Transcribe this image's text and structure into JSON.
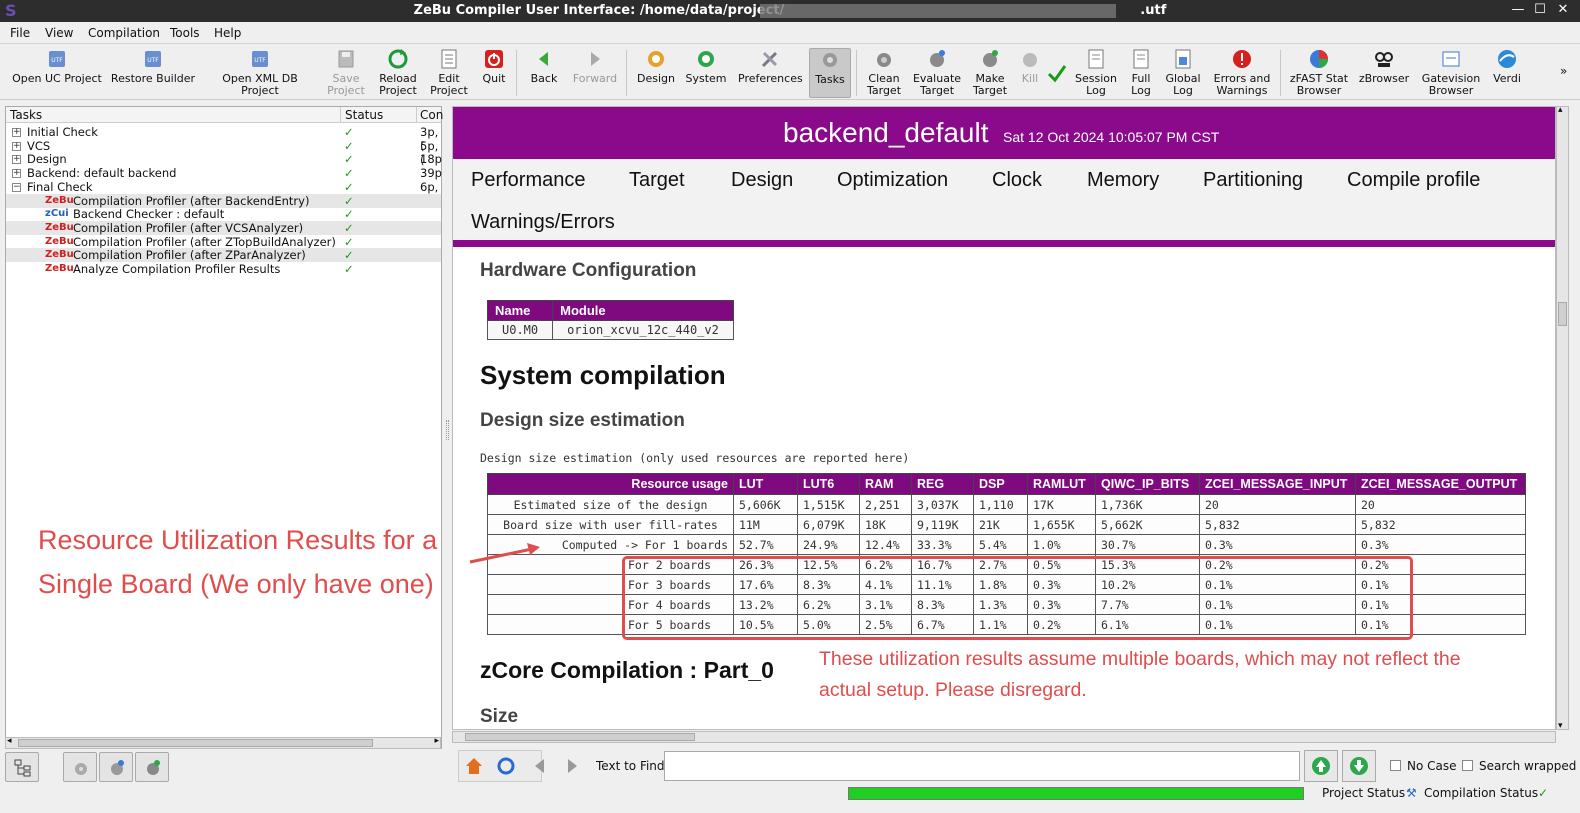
{
  "window": {
    "title": "ZeBu Compiler User Interface: /home/data/project/",
    "title_suffix": ".utf",
    "controls": [
      "—",
      "☐",
      "✕"
    ]
  },
  "menu": [
    "File",
    "View",
    "Compilation",
    "Tools",
    "Help"
  ],
  "toolbar": [
    {
      "line1": "Open UC Project",
      "line2": "",
      "icon": "utf-file-icon"
    },
    {
      "line1": "Restore Builder",
      "line2": "",
      "icon": "utf-file-icon"
    },
    {
      "line1": "Open XML DB Project",
      "line2": "",
      "icon": "utf-file-icon"
    },
    {
      "line1": "Save",
      "line2": "Project",
      "icon": "save-icon",
      "disabled": true
    },
    {
      "line1": "Reload",
      "line2": "Project",
      "icon": "reload-icon"
    },
    {
      "line1": "Edit",
      "line2": "Project",
      "icon": "edit-icon"
    },
    {
      "line1": "Quit",
      "line2": "",
      "icon": "quit-icon"
    },
    {
      "line1": "Back",
      "line2": "",
      "icon": "back-arrow-icon"
    },
    {
      "line1": "Forward",
      "line2": "",
      "icon": "forward-arrow-icon",
      "disabled": true
    },
    {
      "line1": "Design",
      "line2": "",
      "icon": "design-icon"
    },
    {
      "line1": "System",
      "line2": "",
      "icon": "system-icon"
    },
    {
      "line1": "Preferences",
      "line2": "",
      "icon": "preferences-icon"
    },
    {
      "line1": "Tasks",
      "line2": "",
      "icon": "tasks-icon",
      "active": true
    },
    {
      "line1": "Clean",
      "line2": "Target",
      "icon": "clean-target-icon"
    },
    {
      "line1": "Evaluate",
      "line2": "Target",
      "icon": "evaluate-target-icon"
    },
    {
      "line1": "Make",
      "line2": "Target",
      "icon": "make-target-icon"
    },
    {
      "line1": "Kill",
      "line2": "",
      "icon": "kill-icon",
      "disabled": true
    },
    {
      "line1": "Session",
      "line2": "Log",
      "icon": "session-log-icon"
    },
    {
      "line1": "Full",
      "line2": "Log",
      "icon": "full-log-icon"
    },
    {
      "line1": "Global",
      "line2": "Log",
      "icon": "global-log-icon"
    },
    {
      "line1": "Errors and",
      "line2": "Warnings",
      "icon": "errors-icon"
    },
    {
      "line1": "zFAST Stat",
      "line2": "Browser",
      "icon": "zfast-icon"
    },
    {
      "line1": "zBrowser",
      "line2": "",
      "icon": "zbrowser-icon"
    },
    {
      "line1": "Gatevision",
      "line2": "Browser",
      "icon": "gatevision-icon"
    },
    {
      "line1": "Verdi",
      "line2": "",
      "icon": "verdi-icon"
    }
  ],
  "tasks": {
    "headers": [
      "Tasks",
      "Status",
      "Con"
    ],
    "rows": [
      {
        "label": "Initial Check",
        "con": "3p,(",
        "kind": "group",
        "exp": "+"
      },
      {
        "label": "VCS",
        "con": "5p,(",
        "kind": "group",
        "exp": "+"
      },
      {
        "label": "Design",
        "con": "18p",
        "kind": "group",
        "exp": "+"
      },
      {
        "label": "Backend: default backend",
        "con": "39p",
        "kind": "group",
        "exp": "+"
      },
      {
        "label": "Final Check",
        "con": "6p,(",
        "kind": "group",
        "exp": "−"
      },
      {
        "label": "Compilation Profiler (after BackendEntry)",
        "con": "",
        "kind": "zebu",
        "tag": "ZeBu"
      },
      {
        "label": "Backend Checker : default",
        "con": "",
        "kind": "zcui",
        "tag": "zCui"
      },
      {
        "label": "Compilation Profiler (after VCSAnalyzer)",
        "con": "",
        "kind": "zebu",
        "tag": "ZeBu"
      },
      {
        "label": "Compilation Profiler (after ZTopBuildAnalyzer)",
        "con": "",
        "kind": "zebu",
        "tag": "ZeBu"
      },
      {
        "label": "Compilation Profiler (after ZParAnalyzer)",
        "con": "",
        "kind": "zebu",
        "tag": "ZeBu"
      },
      {
        "label": "Analyze Compilation Profiler Results",
        "con": "",
        "kind": "zebu",
        "tag": "ZeBu"
      }
    ],
    "status_mark": "✓"
  },
  "report": {
    "title": "backend_default",
    "date": "Sat 12 Oct 2024 10:05:07 PM CST",
    "nav": [
      "Performance",
      "Target",
      "Design",
      "Optimization",
      "Clock",
      "Memory",
      "Partitioning",
      "Compile profile",
      "Warnings/Errors"
    ],
    "hw_heading": "Hardware Configuration",
    "hw_headers": [
      "Name",
      "Module"
    ],
    "hw_row": [
      "U0.M0",
      "orion_xcvu_12c_440_v2"
    ],
    "sys_heading": "System compilation",
    "dse_heading": "Design size estimation",
    "dse_note": "Design size estimation (only used resources are reported here)",
    "dse_headers": [
      "Resource usage",
      "LUT",
      "LUT6",
      "RAM",
      "REG",
      "DSP",
      "RAMLUT",
      "QIWC_IP_BITS",
      "ZCEI_MESSAGE_INPUT",
      "ZCEI_MESSAGE_OUTPUT"
    ],
    "dse_rows": [
      [
        "Estimated size of the design",
        "5,606K",
        "1,515K",
        "2,251",
        "3,037K",
        "1,110",
        "17K",
        "1,736K",
        "20",
        "20"
      ],
      [
        "Board size with user fill-rates",
        "11M",
        "6,079K",
        "18K",
        "9,119K",
        "21K",
        "1,655K",
        "5,662K",
        "5,832",
        "5,832"
      ],
      [
        "Computed -> For 1 boards",
        "52.7%",
        "24.9%",
        "12.4%",
        "33.3%",
        "5.4%",
        "1.0%",
        "30.7%",
        "0.3%",
        "0.3%"
      ],
      [
        "For 2 boards",
        "26.3%",
        "12.5%",
        "6.2%",
        "16.7%",
        "2.7%",
        "0.5%",
        "15.3%",
        "0.2%",
        "0.2%"
      ],
      [
        "For 3 boards",
        "17.6%",
        "8.3%",
        "4.1%",
        "11.1%",
        "1.8%",
        "0.3%",
        "10.2%",
        "0.1%",
        "0.1%"
      ],
      [
        "For 4 boards",
        "13.2%",
        "6.2%",
        "3.1%",
        "8.3%",
        "1.3%",
        "0.3%",
        "7.7%",
        "0.1%",
        "0.1%"
      ],
      [
        "For 5 boards",
        "10.5%",
        "5.0%",
        "2.5%",
        "6.7%",
        "1.1%",
        "0.2%",
        "6.1%",
        "0.1%",
        "0.1%"
      ]
    ],
    "zcore_heading": "zCore Compilation : Part_0",
    "size_heading": "Size"
  },
  "annotations": {
    "left_line1": "Resource Utilization Results for a",
    "left_line2": "Single Board (We only have one)",
    "right_line1": "These utilization results assume multiple boards, which may not reflect the",
    "right_line2": "actual setup. Please disregard.",
    "color": "#e04d4d"
  },
  "find": {
    "label": "Text to Find",
    "value": "",
    "no_case": "No Case",
    "search_wrapped": "Search wrapped"
  },
  "status": {
    "progress": 1.0,
    "project_status": "Project Status",
    "compilation_status": "Compilation Status"
  }
}
